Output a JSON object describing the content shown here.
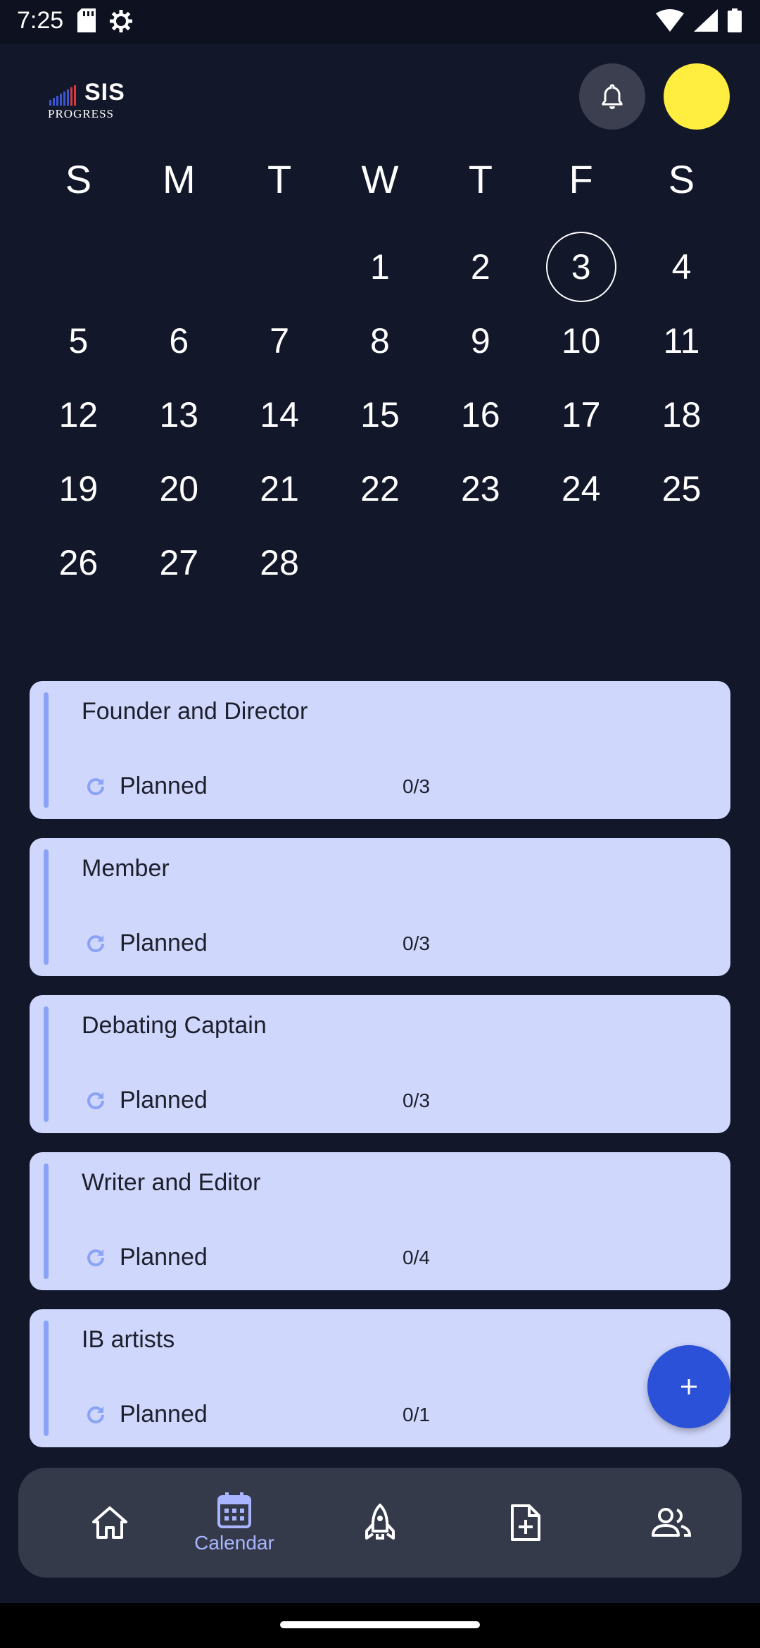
{
  "status_bar": {
    "time": "7:25"
  },
  "logo": {
    "main": "SIS",
    "sub": "PROGRESS"
  },
  "calendar": {
    "weekdays": [
      "S",
      "M",
      "T",
      "W",
      "T",
      "F",
      "S"
    ],
    "weeks": [
      [
        "",
        "",
        "",
        "1",
        "2",
        "3",
        "4"
      ],
      [
        "5",
        "6",
        "7",
        "8",
        "9",
        "10",
        "11"
      ],
      [
        "12",
        "13",
        "14",
        "15",
        "16",
        "17",
        "18"
      ],
      [
        "19",
        "20",
        "21",
        "22",
        "23",
        "24",
        "25"
      ],
      [
        "26",
        "27",
        "28",
        "",
        "",
        "",
        ""
      ]
    ],
    "selected": "3"
  },
  "activities": [
    {
      "title": "Founder and Director",
      "status": "Planned",
      "count": "0/3"
    },
    {
      "title": "Member",
      "status": "Planned",
      "count": "0/3"
    },
    {
      "title": "Debating Captain",
      "status": "Planned",
      "count": "0/3"
    },
    {
      "title": "Writer and Editor",
      "status": "Planned",
      "count": "0/4"
    },
    {
      "title": "IB artists",
      "status": "Planned",
      "count": "0/1"
    }
  ],
  "nav": {
    "calendar_label": "Calendar"
  },
  "colors": {
    "background": "#13172a",
    "card": "#d0d7fc",
    "accent": "#2b51d8",
    "avatar": "#ffed3f"
  }
}
